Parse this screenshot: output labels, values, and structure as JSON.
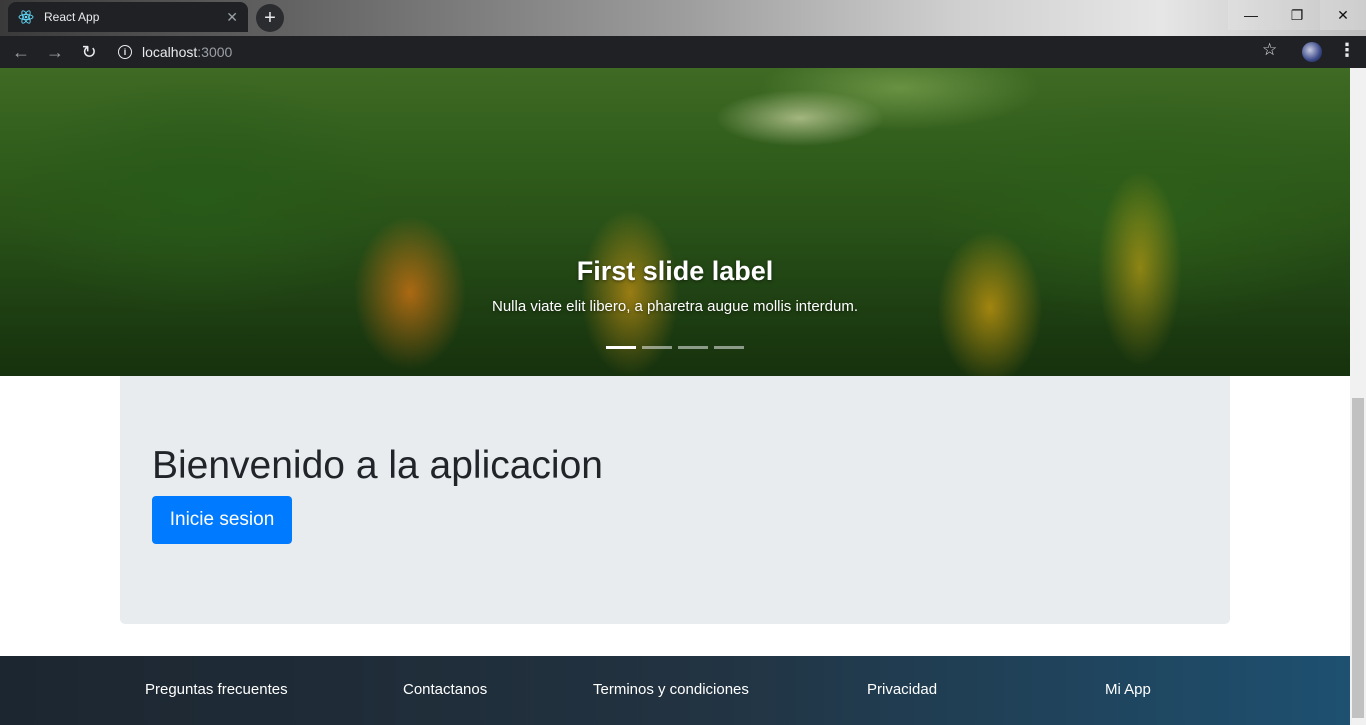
{
  "browser": {
    "tab_title": "React App",
    "tab_close": "✕",
    "new_tab": "+",
    "url_host": "localhost",
    "url_port": ":3000",
    "icons": {
      "back": "back-arrow-icon",
      "forward": "forward-arrow-icon",
      "reload": "reload-icon",
      "info": "info-icon",
      "star": "star-icon",
      "menu": "kebab-menu-icon"
    }
  },
  "carousel": {
    "title": "First slide label",
    "text": "Nulla viate elit libero, a pharetra augue mollis interdum.",
    "indicator_count": 4,
    "active_index": 0
  },
  "jumbotron": {
    "title": "Bienvenido a la aplicacion",
    "button_label": "Inicie sesion",
    "button_color": "#007bff"
  },
  "footer": {
    "links": [
      "Preguntas frecuentes",
      "Contactanos",
      "Terminos y condiciones",
      "Privacidad",
      "Mi App"
    ]
  }
}
